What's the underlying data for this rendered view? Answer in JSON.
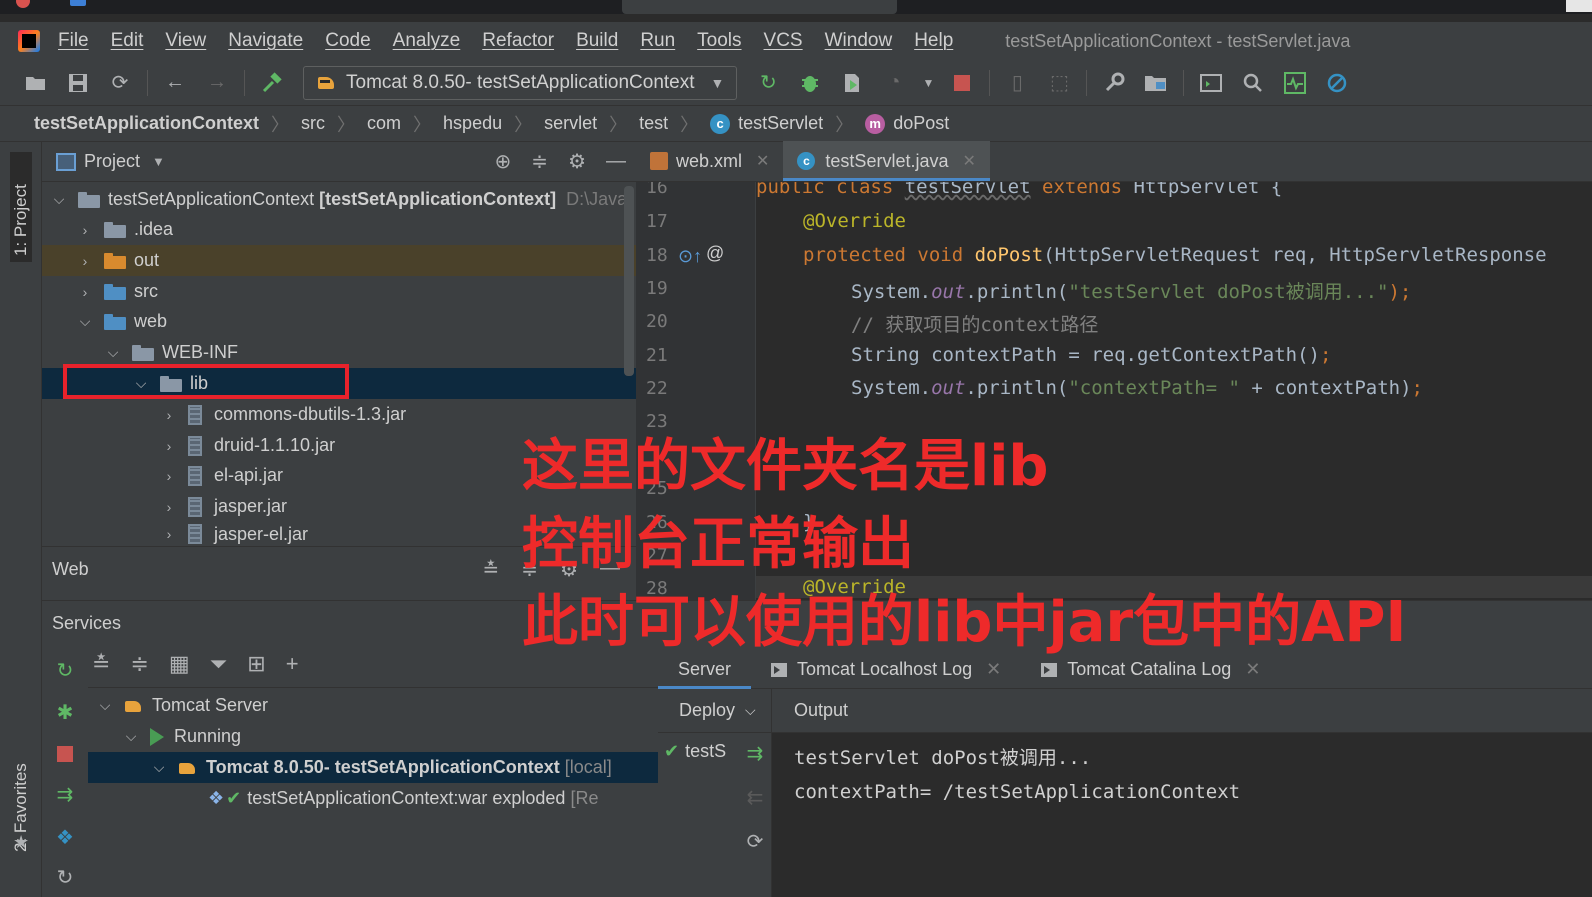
{
  "window": {
    "title": "testSetApplicationContext - testServlet.java"
  },
  "menu": [
    "File",
    "Edit",
    "View",
    "Navigate",
    "Code",
    "Analyze",
    "Refactor",
    "Build",
    "Run",
    "Tools",
    "VCS",
    "Window",
    "Help"
  ],
  "toolbar": {
    "run_config": "Tomcat 8.0.50- testSetApplicationContext"
  },
  "breadcrumb": [
    "testSetApplicationContext",
    "src",
    "com",
    "hspedu",
    "servlet",
    "test",
    "testServlet",
    "doPost"
  ],
  "left_stripe": {
    "project_tab": "1: Project",
    "favorites_tab": "2: Favorites"
  },
  "project": {
    "header": "Project",
    "root_name": "testSetApplicationContext",
    "root_module": "[testSetApplicationContext]",
    "root_path": "D:\\Java",
    "items": [
      ".idea",
      "out",
      "src",
      "web",
      "WEB-INF",
      "lib"
    ],
    "jars": [
      "commons-dbutils-1.3.jar",
      "druid-1.1.10.jar",
      "el-api.jar",
      "jasper.jar",
      "jasper-el.jar"
    ]
  },
  "web_panel": {
    "title": "Web"
  },
  "editor": {
    "tabs": [
      "web.xml",
      "testServlet.java"
    ],
    "line_numbers": [
      "16",
      "17",
      "18",
      "19",
      "20",
      "21",
      "22",
      "23",
      "25",
      "26",
      "27",
      "28"
    ],
    "code": {
      "l16_kw": "public class ",
      "l16_cls": "testServlet",
      "l16_ext": " extends ",
      "l16_rest": "HttpServlet {",
      "l17": "@Override",
      "l18_kw": "protected void ",
      "l18_fn": "doPost",
      "l18_rest": "(HttpServletRequest req, HttpServletResponse",
      "l19_a": "System.",
      "l19_out": "out",
      "l19_b": ".println(",
      "l19_str": "\"testServlet doPost被调用...\"",
      "l19_c": ");",
      "l20": "// 获取项目的context路径",
      "l21_a": "String contextPath = req.getContextPath()",
      "l21_b": ";",
      "l22_a": "System.",
      "l22_out": "out",
      "l22_b": ".println(",
      "l22_str": "\"contextPath= \"",
      "l22_c": " + contextPath)",
      "l22_d": ";",
      "l26": "}",
      "l28": "@Override"
    }
  },
  "services": {
    "title": "Services",
    "tree": {
      "server": "Tomcat Server",
      "running": "Running",
      "config": "Tomcat 8.0.50- testSetApplicationContext",
      "config_suffix": "[local]",
      "artifact": "testSetApplicationContext:war exploded",
      "artifact_suffix": "[Re"
    },
    "tabs": [
      "Server",
      "Tomcat Localhost Log",
      "Tomcat Catalina Log"
    ],
    "deploy_header": "Deploy",
    "deploy_item": "testS",
    "output_header": "Output",
    "output_lines": [
      "testServlet doPost被调用...",
      "contextPath= /testSetApplicationContext"
    ]
  },
  "annotation": {
    "line1": "这里的文件夹名是lib",
    "line2": "控制台正常输出",
    "line3": "此时可以使用的lib中jar包中的API",
    "color": "#ee2a2a"
  },
  "colors": {
    "accent": "#4a88c7",
    "highlight_box": "#e8222b",
    "keyword": "#cc7832",
    "string": "#6a8759"
  }
}
